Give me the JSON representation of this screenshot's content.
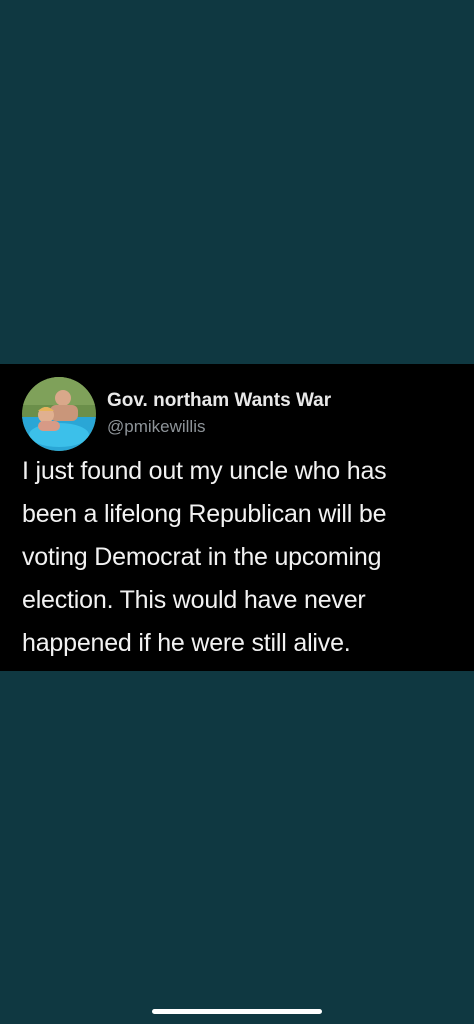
{
  "tweet": {
    "display_name": "Gov. northam Wants War",
    "handle": "@pmikewillis",
    "text_lines": [
      "I just found out my uncle who has",
      "been a lifelong Republican will be",
      "voting Democrat in the upcoming",
      "election. This would have never",
      "happened if he were still alive."
    ],
    "avatar_icon": "profile-photo-pool"
  },
  "colors": {
    "background": "#0f3841",
    "card": "#000000",
    "text": "#f2f2f2",
    "handle": "#8e9499"
  }
}
